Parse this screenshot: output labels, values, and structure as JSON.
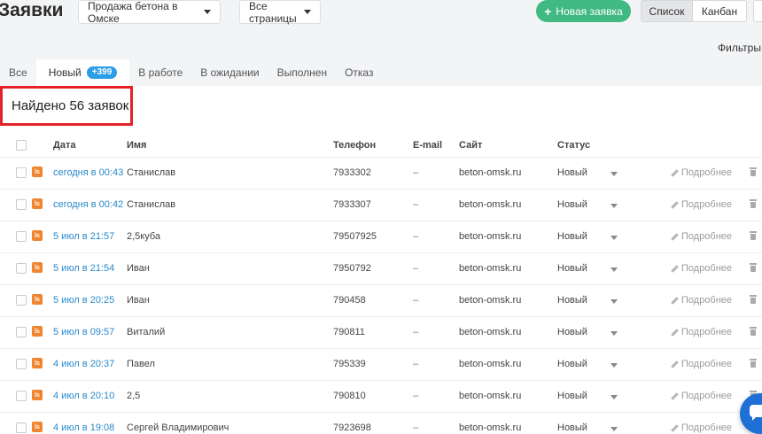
{
  "header": {
    "title": "Заявки",
    "site_select": "Продажа бетона в Омске",
    "pages_select": "Все страницы",
    "new_button": "Новая заявка",
    "view_list": "Список",
    "view_kanban": "Канбан",
    "filters": "Фильтры"
  },
  "tabs": [
    {
      "label": "Все"
    },
    {
      "label": "Новый",
      "badge": "+399"
    },
    {
      "label": "В работе"
    },
    {
      "label": "В ожидании"
    },
    {
      "label": "Выполнен"
    },
    {
      "label": "Отказ"
    }
  ],
  "found_text": "Найдено 56 заявок",
  "table": {
    "columns": {
      "date": "Дата",
      "name": "Имя",
      "phone": "Телефон",
      "email": "E-mail",
      "site": "Сайт",
      "status": "Статус"
    },
    "source_icon_text": "ls",
    "more_label": "Подробнее",
    "rows": [
      {
        "date": "сегодня в 00:43",
        "name": "Станислав",
        "phone": "7933302",
        "email": "–",
        "site": "beton-omsk.ru",
        "status": "Новый"
      },
      {
        "date": "сегодня в 00:42",
        "name": "Станислав",
        "phone": "7933307",
        "email": "–",
        "site": "beton-omsk.ru",
        "status": "Новый"
      },
      {
        "date": "5 июл в 21:57",
        "name": "2,5куба",
        "phone": "79507925",
        "email": "–",
        "site": "beton-omsk.ru",
        "status": "Новый"
      },
      {
        "date": "5 июл в 21:54",
        "name": "Иван",
        "phone": "7950792",
        "email": "–",
        "site": "beton-omsk.ru",
        "status": "Новый"
      },
      {
        "date": "5 июл в 20:25",
        "name": "Иван",
        "phone": "790458",
        "email": "–",
        "site": "beton-omsk.ru",
        "status": "Новый"
      },
      {
        "date": "5 июл в 09:57",
        "name": "Виталий",
        "phone": "790811",
        "email": "–",
        "site": "beton-omsk.ru",
        "status": "Новый"
      },
      {
        "date": "4 июл в 20:37",
        "name": "Павел",
        "phone": "795339",
        "email": "–",
        "site": "beton-omsk.ru",
        "status": "Новый"
      },
      {
        "date": "4 июл в 20:10",
        "name": "2,5",
        "phone": "790810",
        "email": "–",
        "site": "beton-omsk.ru",
        "status": "Новый"
      },
      {
        "date": "4 июл в 19:08",
        "name": "Сергей Владимирович",
        "phone": "7923698",
        "email": "–",
        "site": "beton-omsk.ru",
        "status": "Новый"
      }
    ]
  },
  "colors": {
    "accent_green": "#40b983",
    "badge_blue": "#2c9ee5",
    "link_blue": "#2a89c9",
    "highlight_red": "#e3222a",
    "source_orange": "#f1852f",
    "chat_blue": "#1f6fd6"
  }
}
